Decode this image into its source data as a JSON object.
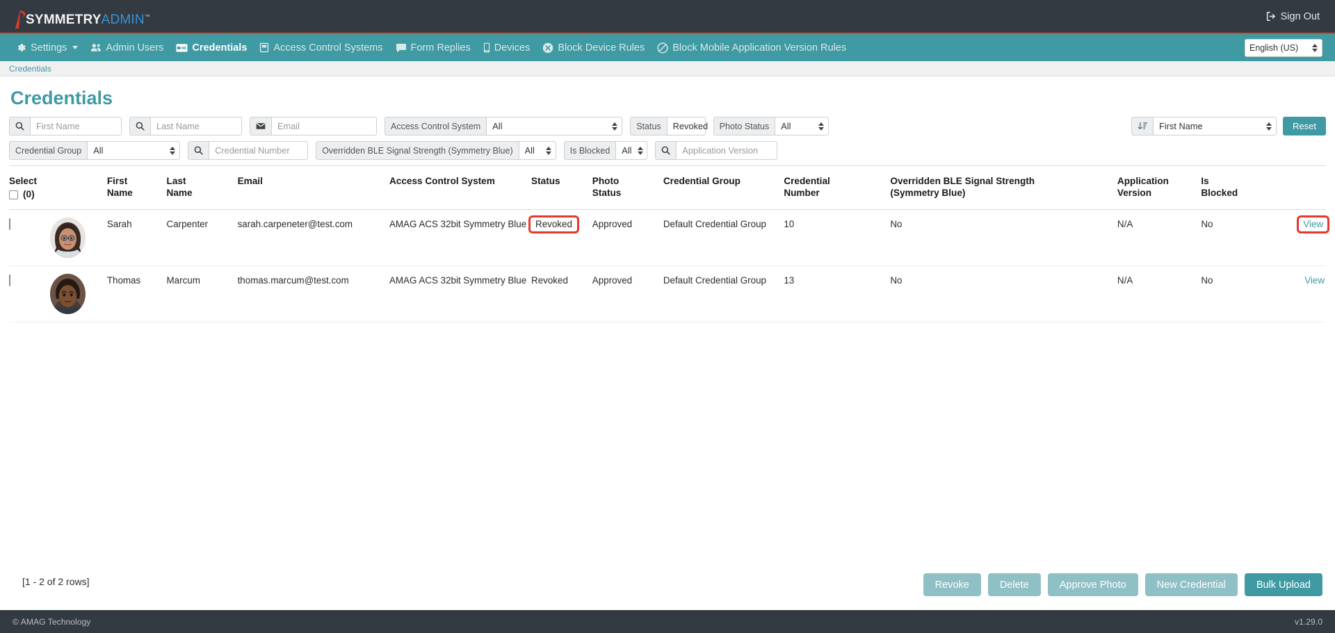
{
  "brand": {
    "name_bold": "SYMMETRY",
    "name_light": "ADMIN",
    "tm": "™",
    "logo_icon": "symmetry-flame-logo",
    "accent_red": "#d9491f",
    "accent_teal": "#3f9aa3",
    "dark": "#343a42",
    "highlight_red": "#e8372b"
  },
  "topbar": {
    "sign_out": "Sign Out",
    "sign_out_icon": "sign-out-icon"
  },
  "nav": {
    "items": [
      {
        "label": "Settings",
        "icon": "gear-icon",
        "active": false,
        "has_caret": true
      },
      {
        "label": "Admin Users",
        "icon": "users-icon",
        "active": false,
        "has_caret": false
      },
      {
        "label": "Credentials",
        "icon": "card-icon",
        "active": true,
        "has_caret": false
      },
      {
        "label": "Access Control Systems",
        "icon": "panel-icon",
        "active": false,
        "has_caret": false
      },
      {
        "label": "Form Replies",
        "icon": "comment-icon",
        "active": false,
        "has_caret": false
      },
      {
        "label": "Devices",
        "icon": "mobile-icon",
        "active": false,
        "has_caret": false
      },
      {
        "label": "Block Device Rules",
        "icon": "circle-x-icon",
        "active": false,
        "has_caret": false
      },
      {
        "label": "Block Mobile Application Version Rules",
        "icon": "circle-slash-icon",
        "active": false,
        "has_caret": false
      }
    ],
    "language": "English (US)"
  },
  "breadcrumb": {
    "label": "Credentials"
  },
  "page": {
    "title": "Credentials"
  },
  "filters": {
    "row1": [
      {
        "name": "first-name",
        "kind": "input",
        "addon_icon": "search-icon",
        "addon_label": "",
        "placeholder": "First Name",
        "value": ""
      },
      {
        "name": "last-name",
        "kind": "input",
        "addon_icon": "search-icon",
        "addon_label": "",
        "placeholder": "Last Name",
        "value": ""
      },
      {
        "name": "email",
        "kind": "input",
        "addon_icon": "envelope-icon",
        "addon_label": "",
        "placeholder": "Email",
        "value": ""
      },
      {
        "name": "access-control-system",
        "kind": "select",
        "addon_icon": "",
        "addon_label": "Access Control System",
        "value": "All"
      },
      {
        "name": "status",
        "kind": "select",
        "addon_icon": "",
        "addon_label": "Status",
        "value": "Revoked"
      },
      {
        "name": "photo-status",
        "kind": "select",
        "addon_icon": "",
        "addon_label": "Photo Status",
        "value": "All"
      }
    ],
    "row2": [
      {
        "name": "credential-group",
        "kind": "select",
        "addon_icon": "",
        "addon_label": "Credential Group",
        "value": "All"
      },
      {
        "name": "credential-number",
        "kind": "input",
        "addon_icon": "search-icon",
        "addon_label": "",
        "placeholder": "Credential Number",
        "value": ""
      },
      {
        "name": "overridden-ble-signal-strength",
        "kind": "select",
        "addon_icon": "",
        "addon_label": "Overridden BLE Signal Strength (Symmetry Blue)",
        "value": "All"
      },
      {
        "name": "is-blocked",
        "kind": "select",
        "addon_icon": "",
        "addon_label": "Is Blocked",
        "value": "All"
      },
      {
        "name": "application-version",
        "kind": "input",
        "addon_icon": "search-icon",
        "addon_label": "",
        "placeholder": "Application Version",
        "value": ""
      }
    ],
    "sort": {
      "icon": "sort-icon",
      "value": "First Name"
    },
    "reset_label": "Reset"
  },
  "table": {
    "headers": {
      "select": "Select",
      "select_count": "(0)",
      "photo": "",
      "first_name": "First\nName",
      "last_name": "Last\nName",
      "email": "Email",
      "access_control_system": "Access Control System",
      "status": "Status",
      "photo_status": "Photo\nStatus",
      "credential_group": "Credential Group",
      "credential_number": "Credential\nNumber",
      "ble": "Overridden BLE Signal Strength\n(Symmetry Blue)",
      "application_version": "Application\nVersion",
      "is_blocked": "Is\nBlocked",
      "action": ""
    },
    "rows": [
      {
        "checked": false,
        "avatar": "avatar-sarah-carpenter",
        "first_name": "Sarah",
        "last_name": "Carpenter",
        "email": "sarah.carpeneter@test.com",
        "access_control_system": "AMAG ACS 32bit Symmetry Blue",
        "status": "Revoked",
        "status_highlighted": true,
        "photo_status": "Approved",
        "credential_group": "Default Credential Group",
        "credential_number": "10",
        "ble": "No",
        "application_version": "N/A",
        "is_blocked": "No",
        "action": "View",
        "action_highlighted": true
      },
      {
        "checked": false,
        "avatar": "avatar-thomas-marcum",
        "first_name": "Thomas",
        "last_name": "Marcum",
        "email": "thomas.marcum@test.com",
        "access_control_system": "AMAG ACS 32bit Symmetry Blue",
        "status": "Revoked",
        "status_highlighted": false,
        "photo_status": "Approved",
        "credential_group": "Default Credential Group",
        "credential_number": "13",
        "ble": "No",
        "application_version": "N/A",
        "is_blocked": "No",
        "action": "View",
        "action_highlighted": false
      }
    ]
  },
  "bottom": {
    "rows_info": "[1 - 2 of 2 rows]",
    "buttons": [
      {
        "label": "Revoke",
        "name": "revoke-button",
        "primary": false
      },
      {
        "label": "Delete",
        "name": "delete-button",
        "primary": false
      },
      {
        "label": "Approve Photo",
        "name": "approve-photo-button",
        "primary": false
      },
      {
        "label": "New Credential",
        "name": "new-credential-button",
        "primary": false
      },
      {
        "label": "Bulk Upload",
        "name": "bulk-upload-button",
        "primary": true
      }
    ]
  },
  "footer": {
    "copyright": "© AMAG Technology",
    "version": "v1.29.0"
  }
}
